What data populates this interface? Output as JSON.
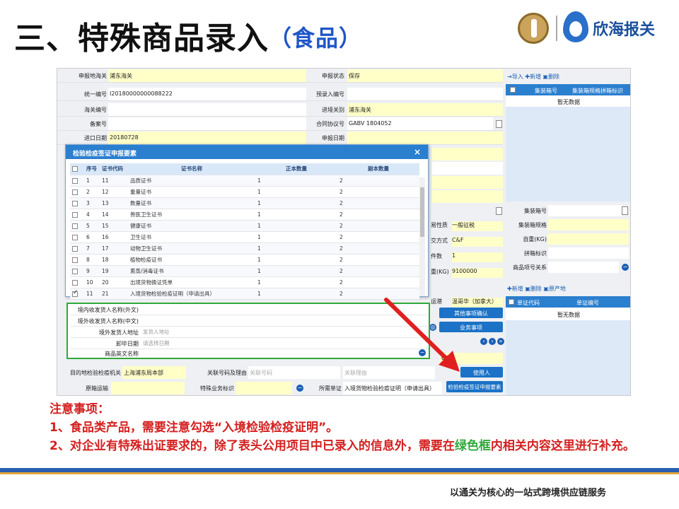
{
  "title": {
    "main": "三、特殊商品录入",
    "sub": "（食品）"
  },
  "logo": {
    "text": "欣海报关"
  },
  "form": {
    "rows": [
      {
        "l1": "申报地海关",
        "v1": "浦东海关",
        "l2": "申报状态",
        "v2": "保存"
      },
      {
        "l1": "统一编号",
        "v1": "I20180000000088222",
        "l2": "预录入编号",
        "v2": ""
      },
      {
        "l1": "海关编号",
        "v1": "",
        "l2": "进境关别",
        "v2": "浦东海关"
      },
      {
        "l1": "备案号",
        "v1": "",
        "l2": "合同协议号",
        "v2": "GABV 1804052"
      },
      {
        "l1": "进口日期",
        "v1": "20180728",
        "l2": "申报日期",
        "v2": ""
      }
    ],
    "right_fields": [
      {
        "label": "易性质",
        "value": "一般征税"
      },
      {
        "label": "交方式",
        "value": "C&F"
      },
      {
        "label": "件数",
        "value": "1"
      },
      {
        "label": "重(KG)",
        "value": "9100000"
      },
      {
        "label": "运港",
        "value": "温哥华（加拿大）"
      }
    ],
    "bottom_rows": [
      {
        "l1": "目的地检验检疫机关",
        "v1": "上海浦东局本部",
        "l2": "关联号码及理由",
        "v2": "关联号码",
        "v3": "关联理由"
      },
      {
        "l1": "原箱运输",
        "v1": "",
        "l2": "特殊业务标识",
        "v2": "",
        "l3": "所需单证",
        "v3": "入境货物检验检疫证明（申请出具）"
      }
    ],
    "buttons": {
      "other": "其他事项确认",
      "business": "业务事项",
      "user": "使用人",
      "cert": "检验检疫签证申报要素"
    },
    "misc": {
      "ref": "04"
    }
  },
  "side_top": {
    "import": "导入",
    "add": "新增",
    "delete": "删除",
    "cols": [
      "集装箱号",
      "集装箱规格",
      "拼箱标识"
    ],
    "empty": "暂无数据"
  },
  "side_mid": {
    "labels": [
      "集装箱号",
      "集装箱规格",
      "自重(KG)",
      "拼箱标识",
      "商品项号关系"
    ]
  },
  "side_bot": {
    "add": "新增",
    "delete": "删除",
    "origin": "原产地",
    "cols": [
      "单证代码",
      "单证编号"
    ],
    "empty": "暂无数据"
  },
  "popup": {
    "title": "检验检疫签证申报要素",
    "close": "×",
    "headers": [
      "序号",
      "证书代码",
      "证书名称",
      "正本数量",
      "副本数量"
    ],
    "rows": [
      {
        "n": "1",
        "code": "11",
        "name": "品质证书",
        "orig": "1",
        "copy": "2",
        "checked": false
      },
      {
        "n": "2",
        "code": "12",
        "name": "重量证书",
        "orig": "1",
        "copy": "2",
        "checked": false
      },
      {
        "n": "3",
        "code": "13",
        "name": "数量证书",
        "orig": "1",
        "copy": "2",
        "checked": false
      },
      {
        "n": "4",
        "code": "14",
        "name": "兽医卫生证书",
        "orig": "1",
        "copy": "2",
        "checked": false
      },
      {
        "n": "5",
        "code": "15",
        "name": "健康证书",
        "orig": "1",
        "copy": "2",
        "checked": false
      },
      {
        "n": "6",
        "code": "16",
        "name": "卫生证书",
        "orig": "1",
        "copy": "2",
        "checked": false
      },
      {
        "n": "7",
        "code": "17",
        "name": "动物卫生证书",
        "orig": "1",
        "copy": "2",
        "checked": false
      },
      {
        "n": "8",
        "code": "18",
        "name": "植物检疫证书",
        "orig": "1",
        "copy": "2",
        "checked": false
      },
      {
        "n": "9",
        "code": "19",
        "name": "熏蒸/消毒证书",
        "orig": "1",
        "copy": "2",
        "checked": false
      },
      {
        "n": "10",
        "code": "20",
        "name": "出境货物换证凭单",
        "orig": "1",
        "copy": "2",
        "checked": false
      },
      {
        "n": "11",
        "code": "21",
        "name": "入境货物检验检疫证明（申请出具）",
        "orig": "1",
        "copy": "2",
        "checked": true
      }
    ]
  },
  "green": {
    "rows": [
      {
        "label": "境内收发货人名称(外文)",
        "value": ""
      },
      {
        "label": "境外收发货人名称(中文)",
        "value": ""
      },
      {
        "label": "境外发货人地址",
        "value": "发货人地址"
      },
      {
        "label": "卸毕日期",
        "value": "请选择日期"
      },
      {
        "label": "商品英文名称",
        "value": ""
      }
    ]
  },
  "notes": {
    "heading": "注意事项：",
    "line1": "1、食品类产品，需要注意勾选“入境检验检疫证明”。",
    "line2_a": "2、对企业有特殊出证要求的，除了表头公用项目中已录入的信息外，需要在",
    "line2_green": "绿色框",
    "line2_b": "内相关内容这里进行补充。"
  },
  "footer": "以通关为核心的一站式跨境供应链服务",
  "colors": {
    "accent": "#2b7fcf",
    "note_red": "#d41f1f",
    "green": "#2fa83a",
    "title_blue": "#1f56c8"
  }
}
